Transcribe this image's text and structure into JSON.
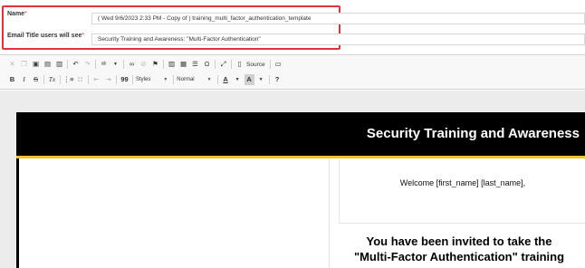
{
  "form": {
    "name_label": "Name",
    "name_required": "*",
    "name_value": "( Wed 9/6/2023 2:33 PM - Copy of ) training_multi_factor_authentication_template",
    "email_title_label": "Email Title users will see",
    "email_title_required": "*",
    "email_title_value": "Security Training and Awareness: \"Multi-Factor Authentication\""
  },
  "toolbar": {
    "row1": [
      "cut-icon",
      "copy-icon",
      "paste-icon",
      "paste-text-icon",
      "paste-word-icon",
      "undo-icon",
      "redo-icon",
      "spellcheck-icon",
      "link-icon",
      "unlink-icon",
      "anchor-icon",
      "image-icon",
      "table-icon",
      "horizontal-line-icon",
      "special-char-icon",
      "maximize-icon",
      "source-icon",
      "iframe-icon"
    ],
    "source_label": "Source",
    "row2": [
      "bold-icon",
      "italic-icon",
      "strike-icon",
      "remove-format-icon",
      "numbered-list-icon",
      "bulleted-list-icon",
      "outdent-icon",
      "indent-icon",
      "blockquote-icon"
    ],
    "bold": "B",
    "italic": "I",
    "strike": "S",
    "remove_format": "Tx",
    "quote": "99",
    "styles_label": "Styles",
    "format_label": "Normal",
    "text_color": "A",
    "bg_color": "A",
    "help": "?"
  },
  "email": {
    "header_title": "Security Training and Awareness",
    "welcome": "Welcome [first_name] [last_name],",
    "invite_line1": "You have been invited to take the",
    "invite_line2": "\"Multi-Factor Authentication\" training"
  },
  "colors": {
    "highlight": "#e2323c",
    "header_bg": "#000000",
    "accent_gold": "#f2c12e"
  }
}
